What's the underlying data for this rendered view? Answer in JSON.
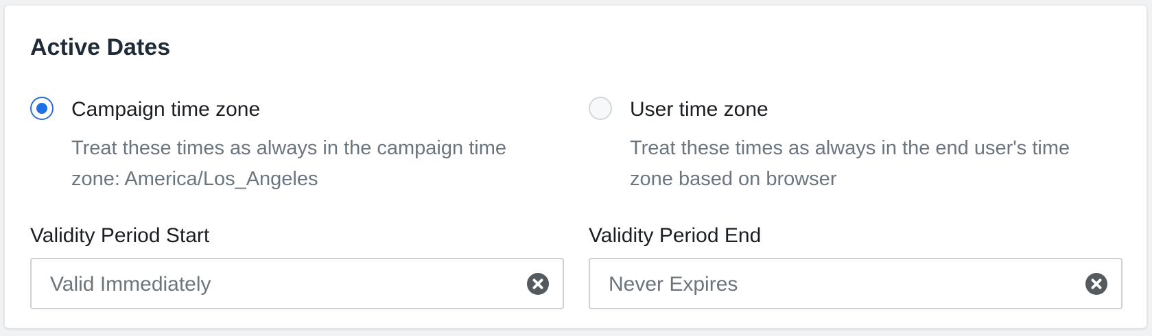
{
  "section": {
    "title": "Active Dates"
  },
  "timezone_options": [
    {
      "label": "Campaign time zone",
      "description": "Treat these times as always in the campaign time zone: America/Los_Angeles",
      "selected": true
    },
    {
      "label": "User time zone",
      "description": "Treat these times as always in the end user's time zone based on browser",
      "selected": false
    }
  ],
  "validity": {
    "start": {
      "label": "Validity Period Start",
      "value": "Valid Immediately",
      "clear_icon": "times-circle-icon"
    },
    "end": {
      "label": "Validity Period End",
      "value": "Never Expires",
      "clear_icon": "times-circle-icon"
    }
  },
  "colors": {
    "accent": "#1f6fe5",
    "title": "#1f2b37",
    "muted_text": "#6b7580",
    "input_border": "#cbd1d7",
    "clear_icon": "#555a5f"
  }
}
